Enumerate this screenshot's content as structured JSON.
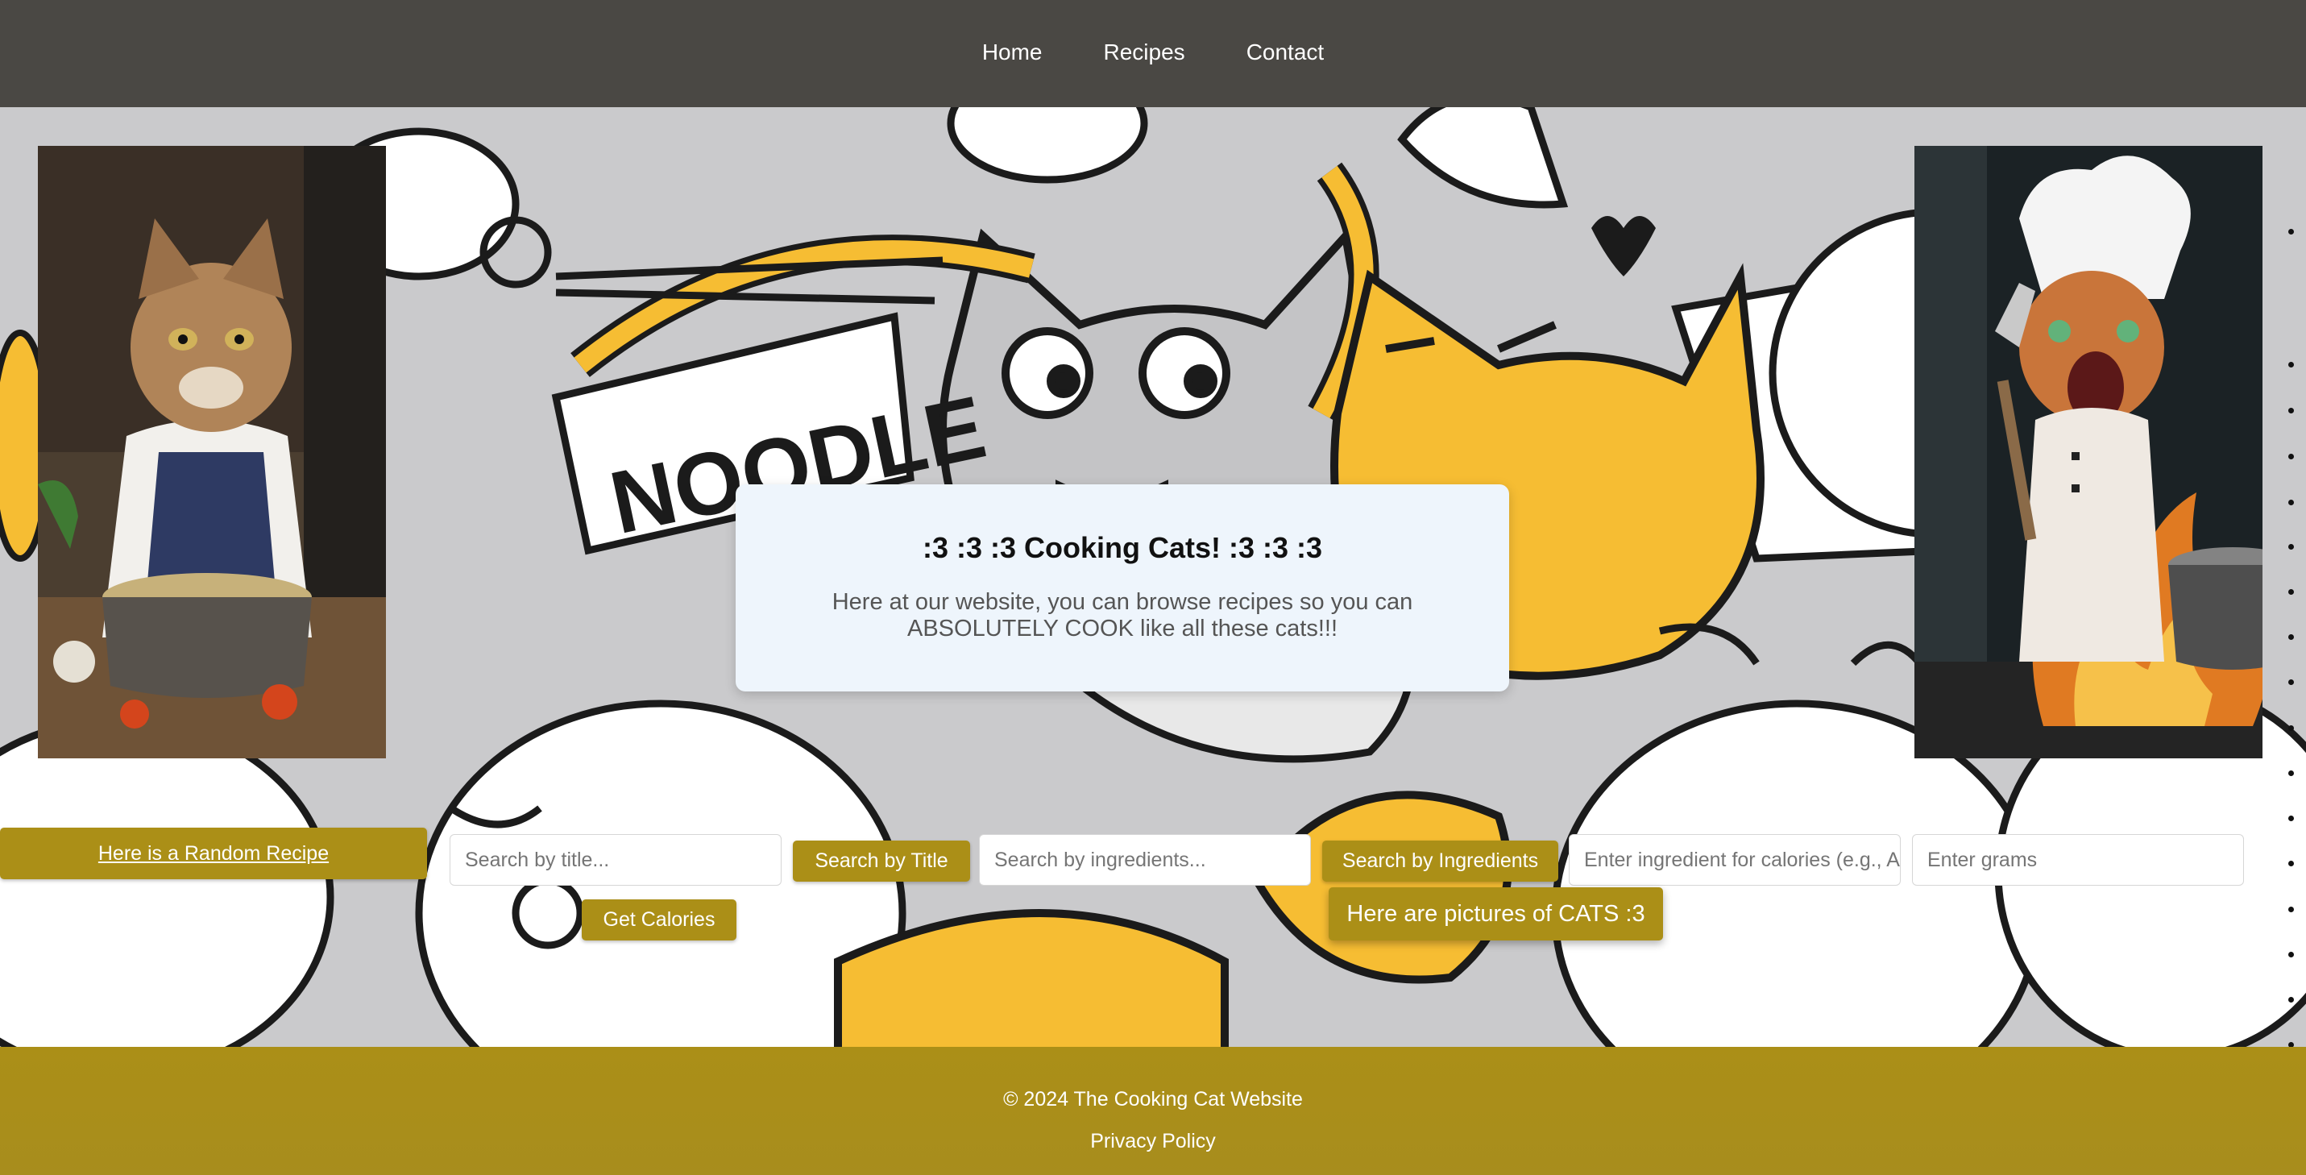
{
  "nav": {
    "links": [
      {
        "label": "Home"
      },
      {
        "label": "Recipes"
      },
      {
        "label": "Contact"
      }
    ]
  },
  "hero": {
    "background_art": "cartoon-cats-eating-noodles",
    "banner_text": "NOODLE",
    "title": ":3 :3 :3 Cooking Cats! :3 :3 :3",
    "description": "Here at our website, you can browse recipes so you can ABSOLUTELY COOK like all these cats!!!"
  },
  "side_images": {
    "left": "tabby-chef-cat-photo",
    "right": "screaming-chef-cat-photo"
  },
  "controls": {
    "random_recipe_label": "Here is a Random Recipe",
    "search_title_placeholder": "Search by title...",
    "search_title_button": "Search by Title",
    "search_ingredients_placeholder": "Search by ingredients...",
    "search_ingredients_button": "Search by Ingredients",
    "calories_ingredient_placeholder": "Enter ingredient for calories (e.g., Apple)",
    "grams_placeholder": "Enter grams",
    "get_calories_button": "Get Calories",
    "cat_pictures_button": "Here are pictures of CATS :3"
  },
  "footer": {
    "copyright": "© 2024 The Cooking Cat Website",
    "privacy_label": "Privacy Policy"
  },
  "colors": {
    "nav_bg": "#4a4844",
    "accent": "#ab8f17",
    "card_bg": "#eef5fc",
    "cartoon_yellow": "#f6bd33"
  }
}
